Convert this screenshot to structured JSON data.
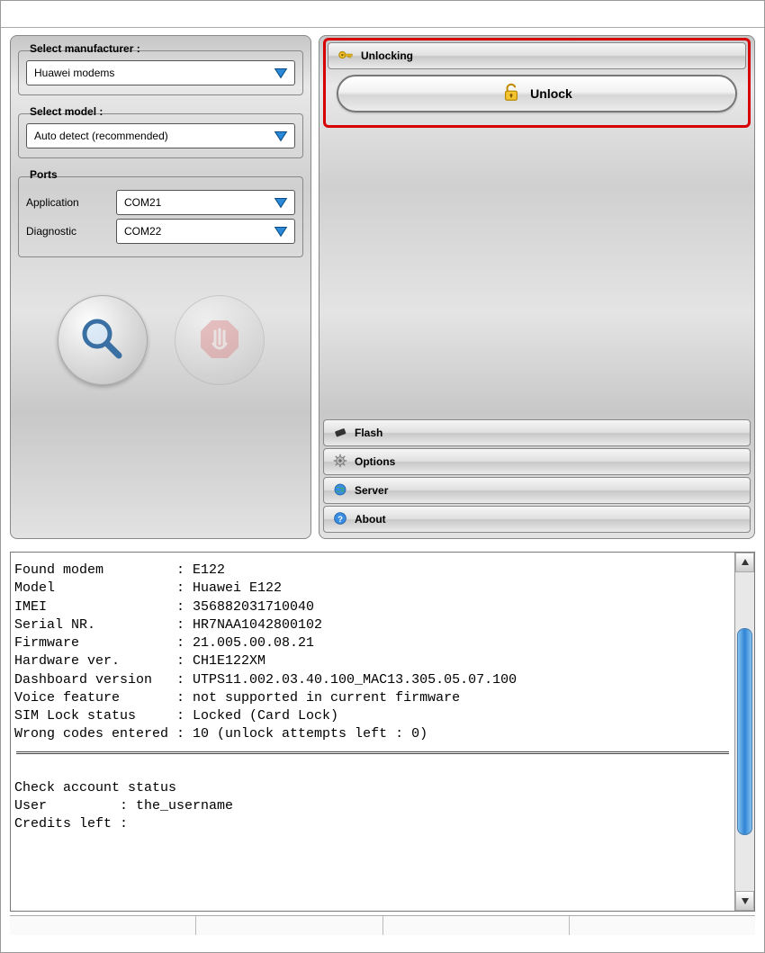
{
  "left": {
    "manufacturer": {
      "label": "Select manufacturer :",
      "value": "Huawei modems"
    },
    "model": {
      "label": "Select model :",
      "value": "Auto detect (recommended)"
    },
    "ports": {
      "label": "Ports",
      "application": {
        "label": "Application",
        "value": "COM21"
      },
      "diagnostic": {
        "label": "Diagnostic",
        "value": "COM22"
      }
    }
  },
  "right": {
    "unlocking": {
      "header": "Unlocking",
      "button": "Unlock"
    },
    "flash": "Flash",
    "options": "Options",
    "server": "Server",
    "about": "About"
  },
  "log": {
    "lines": [
      "Found modem         : E122",
      "Model               : Huawei E122",
      "IMEI                : 356882031710040",
      "Serial NR.          : HR7NAA1042800102",
      "Firmware            : 21.005.00.08.21",
      "Hardware ver.       : CH1E122XM",
      "Dashboard version   : UTPS11.002.03.40.100_MAC13.305.05.07.100",
      "Voice feature       : not supported in current firmware",
      "SIM Lock status     : Locked (Card Lock)",
      "Wrong codes entered : 10 (unlock attempts left : 0)"
    ],
    "lines2": [
      "Check account status",
      "User         : the_username",
      "Credits left :"
    ],
    "info": {
      "found_modem": "E122",
      "model": "Huawei E122",
      "imei": "356882031710040",
      "serial": "HR7NAA1042800102",
      "firmware": "21.005.00.08.21",
      "hardware_ver": "CH1E122XM",
      "dashboard_version": "UTPS11.002.03.40.100_MAC13.305.05.07.100",
      "voice_feature": "not supported in current firmware",
      "sim_lock_status": "Locked (Card Lock)",
      "wrong_codes_entered": "10 (unlock attempts left : 0)",
      "user": "the_username",
      "credits_left": ""
    }
  }
}
